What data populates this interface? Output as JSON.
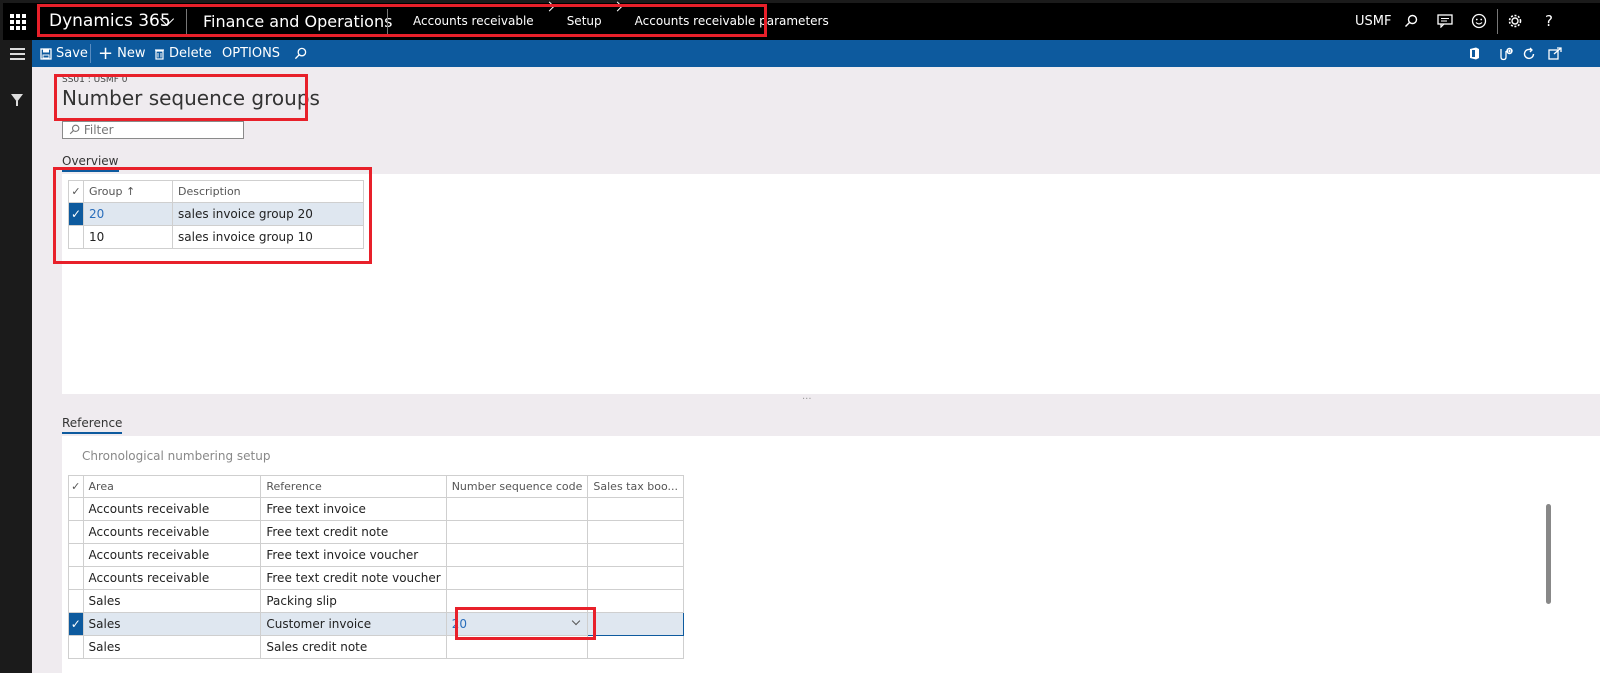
{
  "topbar": {
    "brand": "Dynamics 365",
    "app_name": "Finance and Operations",
    "breadcrumb": [
      "Accounts receivable",
      "Setup",
      "Accounts receivable parameters"
    ],
    "company": "USMF"
  },
  "actions": {
    "save": "Save",
    "new": "New",
    "delete": "Delete",
    "options": "OPTIONS"
  },
  "page": {
    "caption": "SS01 : USMF 0",
    "title": "Number sequence groups",
    "filter_placeholder": "Filter"
  },
  "overview": {
    "tab": "Overview",
    "columns": [
      "Group",
      "Description"
    ],
    "rows": [
      {
        "group": "20",
        "description": "sales invoice group 20",
        "selected": true
      },
      {
        "group": "10",
        "description": "sales invoice group 10",
        "selected": false
      }
    ]
  },
  "reference": {
    "tab": "Reference",
    "section": "Chronological numbering setup",
    "columns": [
      "Area",
      "Reference",
      "Number sequence code",
      "Sales tax boo..."
    ],
    "rows": [
      {
        "area": "Accounts receivable",
        "reference": "Free text invoice",
        "code": "",
        "tax": ""
      },
      {
        "area": "Accounts receivable",
        "reference": "Free text credit note",
        "code": "",
        "tax": ""
      },
      {
        "area": "Accounts receivable",
        "reference": "Free text invoice voucher",
        "code": "",
        "tax": ""
      },
      {
        "area": "Accounts receivable",
        "reference": "Free text credit note voucher",
        "code": "",
        "tax": ""
      },
      {
        "area": "Sales",
        "reference": "Packing slip",
        "code": "",
        "tax": ""
      },
      {
        "area": "Sales",
        "reference": "Customer invoice",
        "code": "20",
        "tax": ""
      },
      {
        "area": "Sales",
        "reference": "Sales credit note",
        "code": "",
        "tax": ""
      }
    ]
  },
  "colors": {
    "accent": "#0d5a9e",
    "highlight": "#e8202a"
  }
}
